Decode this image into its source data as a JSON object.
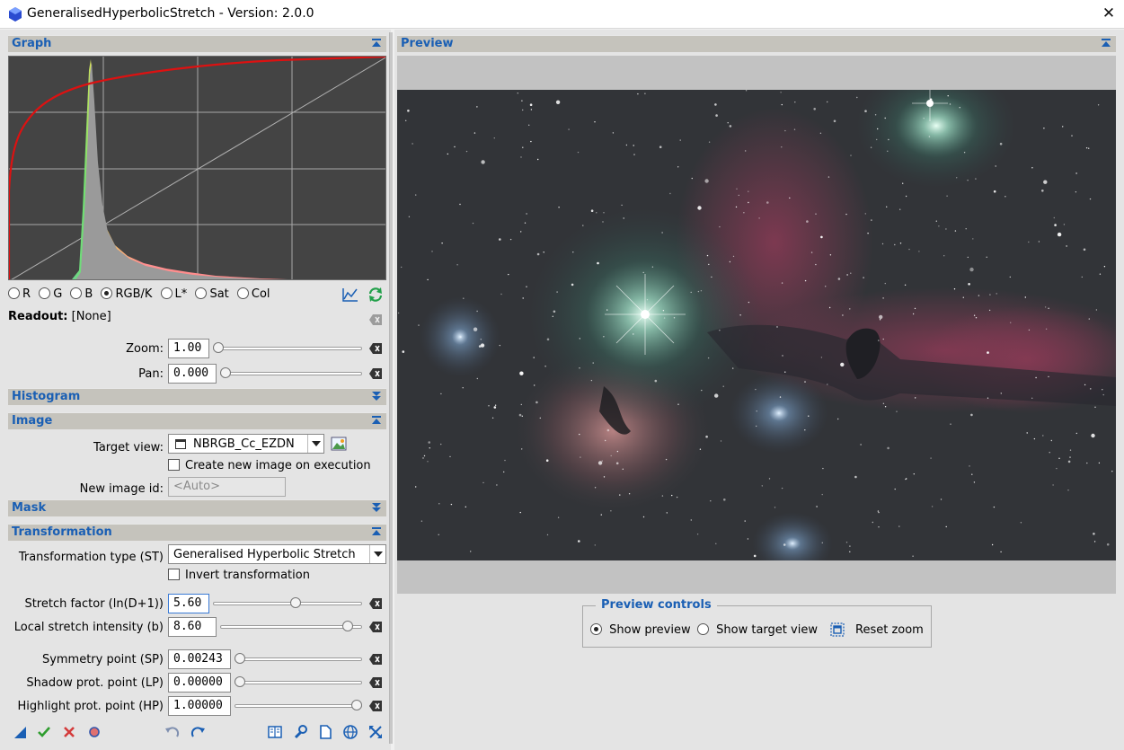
{
  "window": {
    "title": "GeneralisedHyperbolicStretch - Version: 2.0.0"
  },
  "colors": {
    "section_bar": "#c5c3bc",
    "section_title": "#1a5fb4",
    "graph_bg": "#444444",
    "curve": "#dd1111",
    "histogram": "#999999",
    "accent_ok": "#2e9d2e",
    "accent_cancel": "#d43b3b"
  },
  "graph": {
    "title": "Graph",
    "channels": [
      {
        "label": "R",
        "selected": false
      },
      {
        "label": "G",
        "selected": false
      },
      {
        "label": "B",
        "selected": false
      },
      {
        "label": "RGB/K",
        "selected": true
      },
      {
        "label": "L*",
        "selected": false
      },
      {
        "label": "Sat",
        "selected": false
      },
      {
        "label": "Col",
        "selected": false
      }
    ],
    "readout_label": "Readout:",
    "readout_value": "[None]",
    "zoom": {
      "label": "Zoom:",
      "value": "1.00",
      "slider_fraction": 0.0
    },
    "pan": {
      "label": "Pan:",
      "value": "0.000",
      "slider_fraction": 0.0
    }
  },
  "histogram_section": {
    "title": "Histogram"
  },
  "image": {
    "title": "Image",
    "target_view_label": "Target view:",
    "target_view_value": "NBRGB_Cc_EZDN",
    "create_new_label": "Create new image on execution",
    "create_new_checked": false,
    "new_image_id_label": "New image id:",
    "new_image_id_placeholder": "<Auto>"
  },
  "mask": {
    "title": "Mask"
  },
  "transformation": {
    "title": "Transformation",
    "type_label": "Transformation type (ST)",
    "type_value": "Generalised Hyperbolic Stretch",
    "invert_label": "Invert transformation",
    "invert_checked": false,
    "stretch": {
      "label": "Stretch factor (ln(D+1))",
      "value": "5.60",
      "slider_fraction": 0.56
    },
    "local": {
      "label": "Local stretch intensity (b)",
      "value": "8.60",
      "slider_fraction": 0.93
    },
    "sp": {
      "label": "Symmetry point (SP)",
      "value": "0.00243",
      "slider_fraction": 0.0
    },
    "lp": {
      "label": "Shadow prot. point (LP)",
      "value": "0.00000",
      "slider_fraction": 0.0
    },
    "hp": {
      "label": "Highlight prot. point (HP)",
      "value": "1.00000",
      "slider_fraction": 1.0
    }
  },
  "bottom_toolbar": {
    "icons": [
      "new-instance-icon",
      "apply-icon",
      "cancel-icon",
      "reset-icon",
      "undo-icon",
      "redo-icon",
      "documentation-icon",
      "preferences-icon",
      "copy-icon",
      "browse-icon",
      "expand-icon"
    ]
  },
  "preview": {
    "title": "Preview",
    "controls_title": "Preview controls",
    "show_preview_label": "Show preview",
    "show_preview_selected": true,
    "show_target_label": "Show target view",
    "show_target_selected": false,
    "reset_zoom_label": "Reset zoom"
  }
}
